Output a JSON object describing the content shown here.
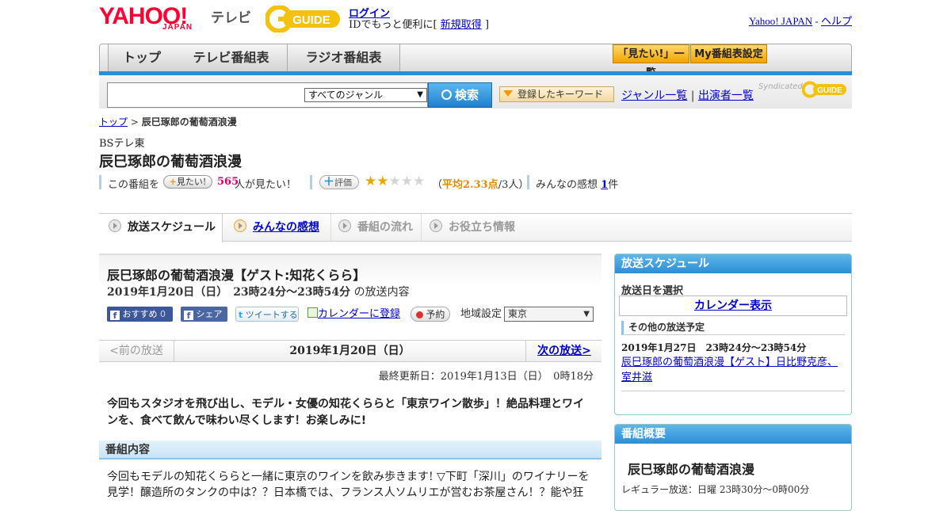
{
  "header": {
    "yahoo_logo": "YAHOO!",
    "japan_logo": "JAPAN",
    "tv_logo": "テレビ",
    "gguide_logo": "GUIDE",
    "login": "ログイン",
    "login_sub_prefix": "IDでもっと便利に[",
    "signup": "新規取得",
    "login_sub_suffix": "]",
    "yahoo_japan_link": "Yahoo! JAPAN",
    "separator": "-",
    "help_link": "ヘルプ"
  },
  "nav": {
    "tabs": [
      "トップ",
      "テレビ番組表",
      "ラジオ番組表"
    ],
    "mitai_list": "「見たい!」一覧",
    "my_schedule": "My番組表設定"
  },
  "search": {
    "genre": "すべてのジャンル",
    "button": "検索",
    "keyword_button": "登録したキーワード",
    "genre_list": "ジャンル一覧",
    "divider": "|",
    "performer_list": "出演者一覧",
    "syndicated": "Syndicated",
    "syndicated_logo": "GUIDE"
  },
  "breadcrumb": {
    "top": "トップ",
    "sep": ">",
    "current": "辰巳琢郎の葡萄酒浪漫"
  },
  "program": {
    "channel": "BSテレ東",
    "title": "辰巳琢郎の葡萄酒浪漫",
    "stats": {
      "mitai_prefix": "この番組を",
      "mitai_button": "見たい!",
      "mitai_count": "565",
      "mitai_suffix": "人が見たい！",
      "rating_button": "評価",
      "rating_value": 2.33,
      "rating_open": "（",
      "rating_text": "平均2.33点",
      "rating_count": "/3人）",
      "impressions_label": "みんなの感想",
      "impressions_count": "1",
      "impressions_suffix": "件"
    }
  },
  "subtabs": [
    "放送スケジュール",
    "みんなの感想",
    "番組の流れ",
    "お役立ち情報"
  ],
  "episode": {
    "title": "辰巳琢郎の葡萄酒浪漫【ゲスト:知花くらら】",
    "date": "2019年1月20日（日）　23時24分～23時54分",
    "date_suffix": "の放送内容",
    "social": {
      "recommend": "おすすめ",
      "recommend_count": "0",
      "share": "シェア",
      "tweet": "ツイートする",
      "calendar": "カレンダーに登録",
      "reserve": "予約"
    },
    "region_label": "地域設定",
    "region": "東京",
    "pager": {
      "prev": "<前の放送",
      "current": "2019年1月20日（日）",
      "next": "次の放送>"
    },
    "updated": "最終更新日：2019年1月13日（日）　0時18分",
    "summary": "今回もスタジオを飛び出し、モデル・女優の知花くららと「東京ワイン散歩」！絶品料理とワインを、食べて飲んで味わい尽くします！お楽しみに!",
    "section_title": "番組内容",
    "section_body": "今回もモデルの知花くららと一緒に東京のワインを飲み歩きます! ▽下町「深川」のワイナリーを見学！醸造所のタンクの中は？？日本橋では、フランス人ソムリエが営むお茶屋さん！？能や狂"
  },
  "sidebar": {
    "schedule": {
      "title": "放送スケジュール",
      "select_label": "放送日を選択",
      "calendar_link": "カレンダー表示",
      "other_label": "その他の放送予定",
      "other_date": "2019年1月27日　23時24分～23時54分",
      "other_title": "辰巳琢郎の葡萄酒浪漫【ゲスト】日比野克彦、室井滋"
    },
    "overview": {
      "title": "番組概要",
      "program_name": "辰巳琢郎の葡萄酒浪漫",
      "regular": "レギュラー放送：日曜 23時30分～0時00分"
    }
  }
}
